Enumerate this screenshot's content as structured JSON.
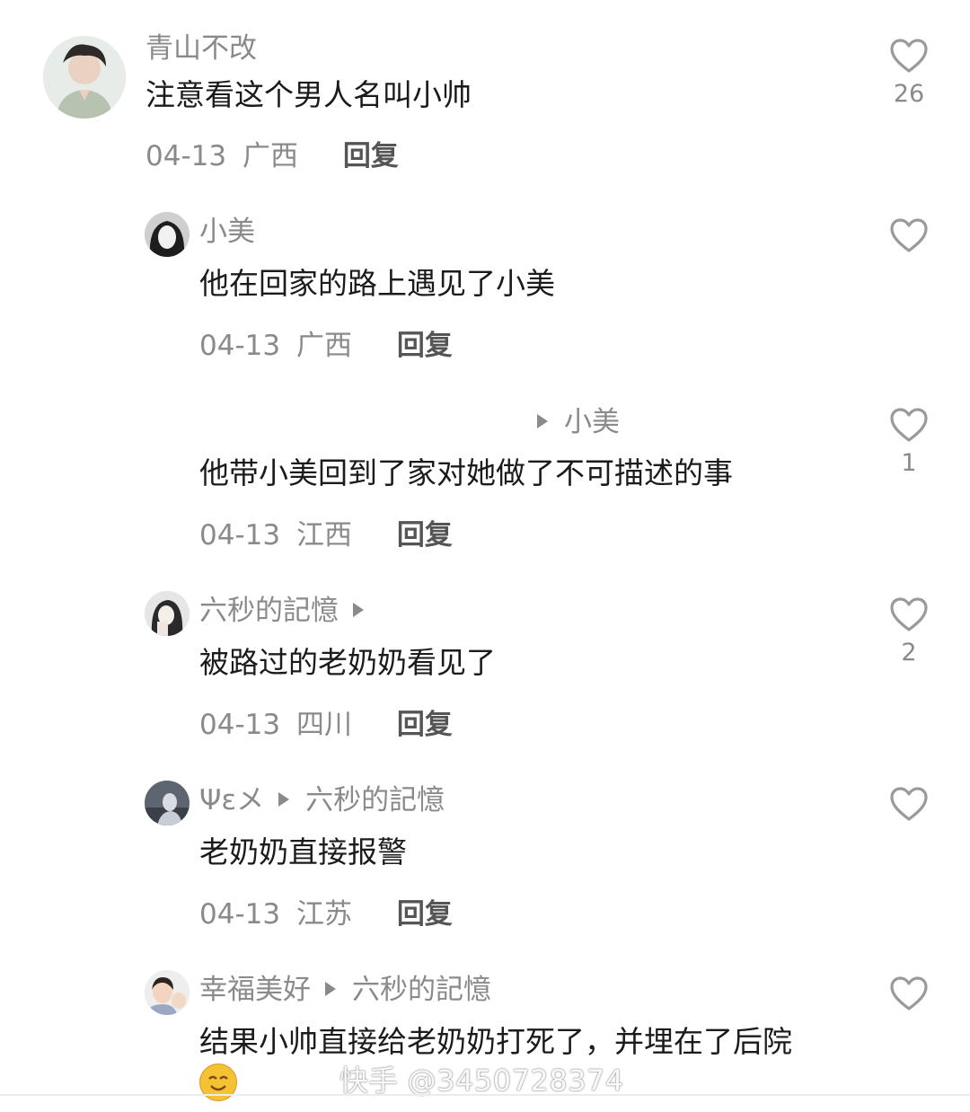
{
  "comments": [
    {
      "user": "青山不改",
      "text": "注意看这个男人名叫小帅",
      "date": "04-13",
      "region": "广西",
      "reply": "回复",
      "likes": "26"
    },
    {
      "user": "小美",
      "text": "他在回家的路上遇见了小美",
      "date": "04-13",
      "region": "广西",
      "reply": "回复",
      "likes": ""
    },
    {
      "reply_to": "小美",
      "text": "他带小美回到了家对她做了不可描述的事",
      "date": "04-13",
      "region": "江西",
      "reply": "回复",
      "likes": "1"
    },
    {
      "user": "六秒的記憶",
      "text": "被路过的老奶奶看见了",
      "date": "04-13",
      "region": "四川",
      "reply": "回复",
      "likes": "2"
    },
    {
      "user": "Ψεメ",
      "reply_to": "六秒的記憶",
      "text": "老奶奶直接报警",
      "date": "04-13",
      "region": "江苏",
      "reply": "回复",
      "likes": ""
    },
    {
      "user": "幸福美好",
      "reply_to": "六秒的記憶",
      "text": "结果小帅直接给老奶奶打死了，并埋在了后院",
      "likes": ""
    }
  ],
  "watermark": "快手 @3450728374",
  "colors": {
    "primary_text": "#1b1b1b",
    "secondary_text": "#8a8a8a",
    "reply_text": "#555555",
    "like_icon": "#9a9a9a"
  },
  "icons": {
    "like": "heart-outline-icon",
    "reply_arrow": "triangle-right-icon",
    "emoji": "smiling-face-emoji"
  }
}
